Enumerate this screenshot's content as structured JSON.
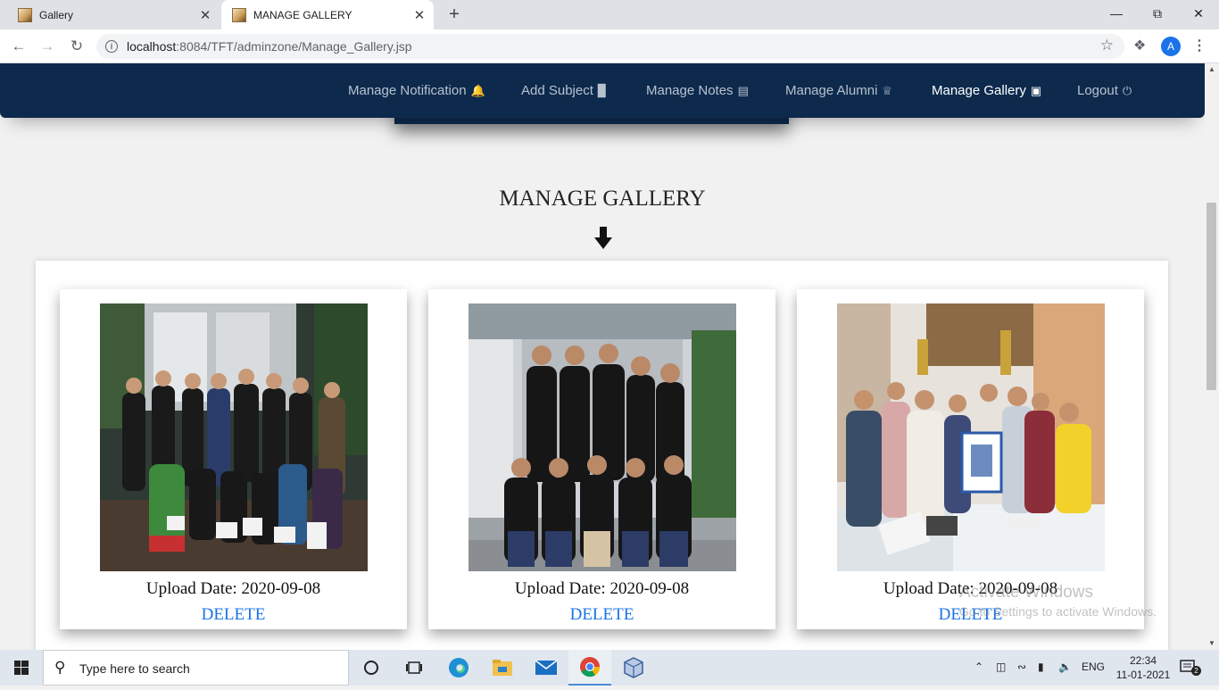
{
  "browser": {
    "tabs": [
      {
        "title": "Gallery",
        "active": false
      },
      {
        "title": "MANAGE GALLERY",
        "active": true
      }
    ],
    "url_host": "localhost",
    "url_rest": ":8084/TFT/adminzone/Manage_Gallery.jsp",
    "profile_initial": "A"
  },
  "site_nav": {
    "items": [
      {
        "label": "Manage Notification",
        "icon": "bell-icon"
      },
      {
        "label": "Add Subject",
        "icon": "book-icon"
      },
      {
        "label": "Manage Notes",
        "icon": "list-icon"
      },
      {
        "label": "Manage Alumni",
        "icon": "graduate-icon"
      },
      {
        "label": "Manage Gallery",
        "icon": "image-icon"
      },
      {
        "label": "Logout",
        "icon": "power-icon"
      }
    ],
    "active": "Manage Gallery"
  },
  "page": {
    "heading": "MANAGE GALLERY"
  },
  "gallery": {
    "items": [
      {
        "upload_date": "Upload Date: 2020-09-08",
        "action": "DELETE"
      },
      {
        "upload_date": "Upload Date: 2020-09-08",
        "action": "DELETE"
      },
      {
        "upload_date": "Upload Date: 2020-09-08",
        "action": "DELETE"
      }
    ]
  },
  "watermark": {
    "line1": "Activate Windows",
    "line2": "Go to Settings to activate Windows."
  },
  "taskbar": {
    "search_placeholder": "Type here to search",
    "language": "ENG",
    "time": "22:34",
    "date": "11-01-2021",
    "notification_count": "2"
  },
  "colors": {
    "nav_bg": "#0d2a4d",
    "delete_link": "#1a73e8"
  }
}
